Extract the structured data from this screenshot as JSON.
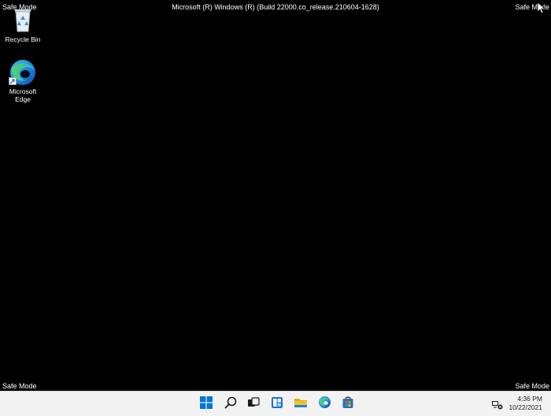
{
  "screen": {
    "safe_mode_top_left": "Safe Mode",
    "safe_mode_top_right": "Safe Mode",
    "safe_mode_bottom_left": "Safe Mode",
    "safe_mode_bottom_right": "Safe Mode",
    "build_info": "Microsoft (R) Windows (R) (Build 22000.co_release.210604-1628)"
  },
  "desktop_icons": [
    {
      "label": "Recycle Bin",
      "icon": "recycle-bin-icon"
    },
    {
      "label": "Microsoft\nEdge",
      "icon": "edge-icon"
    }
  ],
  "taskbar": {
    "pinned": [
      {
        "name": "start",
        "icon": "windows-logo-icon"
      },
      {
        "name": "search",
        "icon": "search-icon"
      },
      {
        "name": "task-view",
        "icon": "task-view-icon"
      },
      {
        "name": "widgets",
        "icon": "widgets-icon"
      },
      {
        "name": "file-explorer",
        "icon": "folder-icon"
      },
      {
        "name": "edge",
        "icon": "edge-icon"
      },
      {
        "name": "store",
        "icon": "store-icon"
      }
    ],
    "tray": {
      "network_icon": "network-disconnected-icon",
      "time": "4:36 PM",
      "date": "10/22/2021"
    }
  },
  "colors": {
    "desktop_bg": "#000000",
    "taskbar_bg": "#f2f2f2",
    "windows_blue": "#0078d4",
    "folder_yellow": "#f4c22b"
  }
}
